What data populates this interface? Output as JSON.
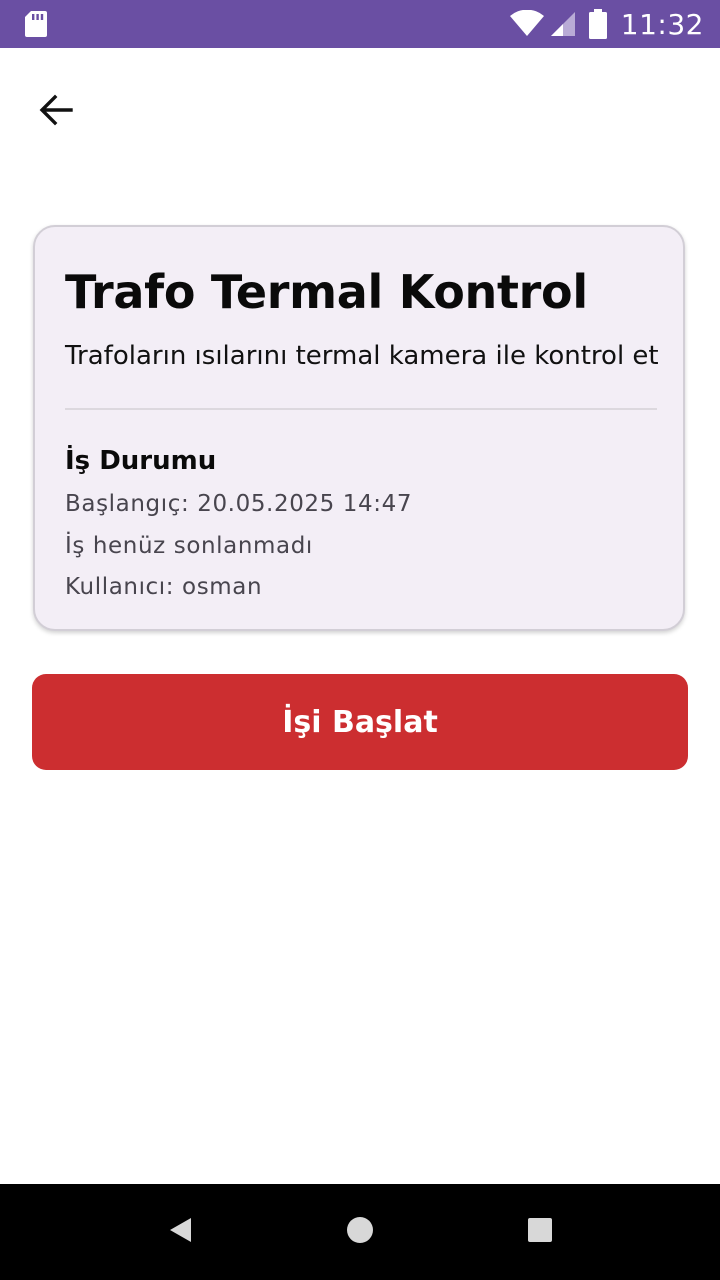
{
  "status_bar": {
    "time": "11:32",
    "icons": [
      "sd-card-icon",
      "wifi-icon",
      "signal-icon",
      "battery-icon"
    ]
  },
  "colors": {
    "status_bar_bg": "#6a4fa3",
    "card_bg": "#f3eef6",
    "primary_button_bg": "#cc2e30",
    "nav_bar_bg": "#000000"
  },
  "header": {
    "back_icon": "arrow-back-icon"
  },
  "card": {
    "title": "Trafo Termal Kontrol",
    "description": "Trafoların ısılarını termal kamera ile kontrol et",
    "status_heading": "İş Durumu",
    "start_line": "Başlangıç: 20.05.2025 14:47",
    "end_line": "İş henüz sonlanmadı",
    "user_line": "Kullanıcı: osman"
  },
  "actions": {
    "start_label": "İşi Başlat"
  },
  "nav_bar": {
    "icons": [
      "nav-back-icon",
      "nav-home-icon",
      "nav-recents-icon"
    ]
  }
}
